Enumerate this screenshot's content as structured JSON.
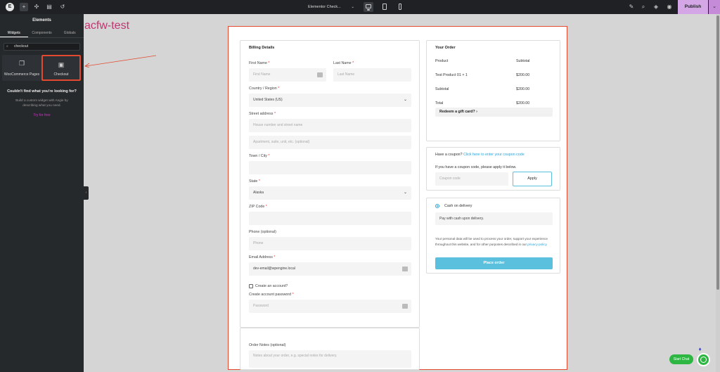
{
  "topbar": {
    "logo": "E",
    "add_icon": "+",
    "page_title": "Elementor Check...",
    "publish_label": "Publish"
  },
  "panel": {
    "title": "Elements",
    "tabs": [
      {
        "label": "Widgets"
      },
      {
        "label": "Components"
      },
      {
        "label": "Globals"
      }
    ],
    "search_value": "checkout",
    "widgets": [
      {
        "label": "WooCommerce Pages",
        "icon": "woocommerce-pages-icon"
      },
      {
        "label": "Checkout",
        "icon": "checkout-icon"
      }
    ],
    "not_found_title": "Couldn't find what you're looking for?",
    "not_found_desc": "Build a custom widget with Angie by describing what you need.",
    "try_label": "Try for free"
  },
  "canvas": {
    "site_title": "acfw-test"
  },
  "billing": {
    "heading": "Billing Details",
    "first_name_label": "First Name",
    "first_name_placeholder": "First Name",
    "last_name_label": "Last Name",
    "last_name_placeholder": "Last Name",
    "country_label": "Country / Region",
    "country_value": "United States (US)",
    "street_label": "Street address",
    "street_placeholder": "House number and street name",
    "street2_placeholder": "Apartment, suite, unit, etc. (optional)",
    "town_label": "Town / City",
    "state_label": "State",
    "state_value": "Alaska",
    "zip_label": "ZIP Code",
    "phone_label": "Phone (optional)",
    "phone_placeholder": "Phone",
    "email_label": "Email Address",
    "email_value": "dev-email@wpengine.local",
    "create_account_label": "Create an account?",
    "password_label": "Create account password",
    "password_placeholder": "Password",
    "required_mark": "*"
  },
  "notes": {
    "label": "Order Notes (optional)",
    "placeholder": "Notes about your order, e.g. special notes for delivery."
  },
  "order": {
    "heading": "Your Order",
    "col_product": "Product",
    "col_subtotal": "Subtotal",
    "item_name": "Test Product 01",
    "item_qty": "× 1",
    "item_price": "$200.00",
    "subtotal_label": "Subtotal",
    "subtotal_value": "$200.00",
    "total_label": "Total",
    "total_value": "$200.00",
    "redeem_label": "Redeem a gift card?"
  },
  "coupon": {
    "question": "Have a coupon?",
    "link": "Click here to enter your coupon code",
    "desc": "If you have a coupon code, please apply it below.",
    "placeholder": "Coupon code",
    "apply_label": "Apply"
  },
  "payment": {
    "method": "Cash on delivery",
    "method_desc": "Pay with cash upon delivery.",
    "privacy_text": "Your personal data will be used to process your order, support your experience throughout this website, and for other purposes described in our",
    "privacy_link": "privacy policy",
    "place_order_label": "Place order"
  },
  "chat": {
    "label": "Start Chat"
  },
  "colors": {
    "accent": "#e2492f",
    "publish": "#d5a6e6",
    "site_title": "#c23470",
    "place_order": "#5bc0de",
    "chat": "#2db742"
  }
}
